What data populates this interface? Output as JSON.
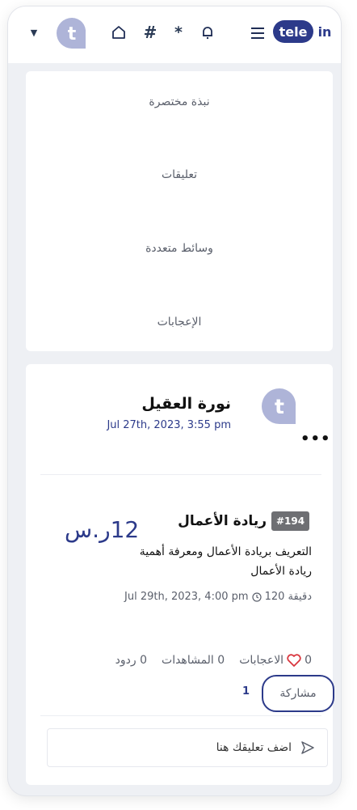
{
  "topbar": {
    "icons": [
      "caret-down-icon",
      "avatar-icon",
      "home-icon",
      "hash-icon",
      "star-icon",
      "bell-icon",
      "menu-icon"
    ],
    "hash_glyph": "#",
    "star_glyph": "*",
    "logo_left": "tele",
    "logo_right": "in",
    "brand_color": "#2c3a8a"
  },
  "profile_stats": {
    "items": [
      {
        "label": "نبذة مختصرة"
      },
      {
        "label": "تعليقات"
      },
      {
        "label": "وسائط متعددة"
      },
      {
        "label": "الإعجابات"
      }
    ]
  },
  "post": {
    "author": "نورة العقيل",
    "date": "Jul 27th, 2023, 3:55 pm",
    "avatar_letter": "t",
    "event": {
      "badge": "#194",
      "title": "ريادة الأعمال",
      "price": "12ر.س",
      "description": "التعريف بريادة الأعمال ومعرفة أهمية ريادة الأعمال",
      "duration": "120 دقيقة",
      "datetime": "Jul 29th, 2023, 4:00 pm"
    },
    "stats": {
      "likes_count": "0",
      "likes_label": "الاعجابات",
      "views": "0 المشاهدات",
      "replies": "0 ردود"
    },
    "share_label": "مشاركة",
    "share_count": "1",
    "comment_placeholder": "اضف تعليقك هنا"
  }
}
